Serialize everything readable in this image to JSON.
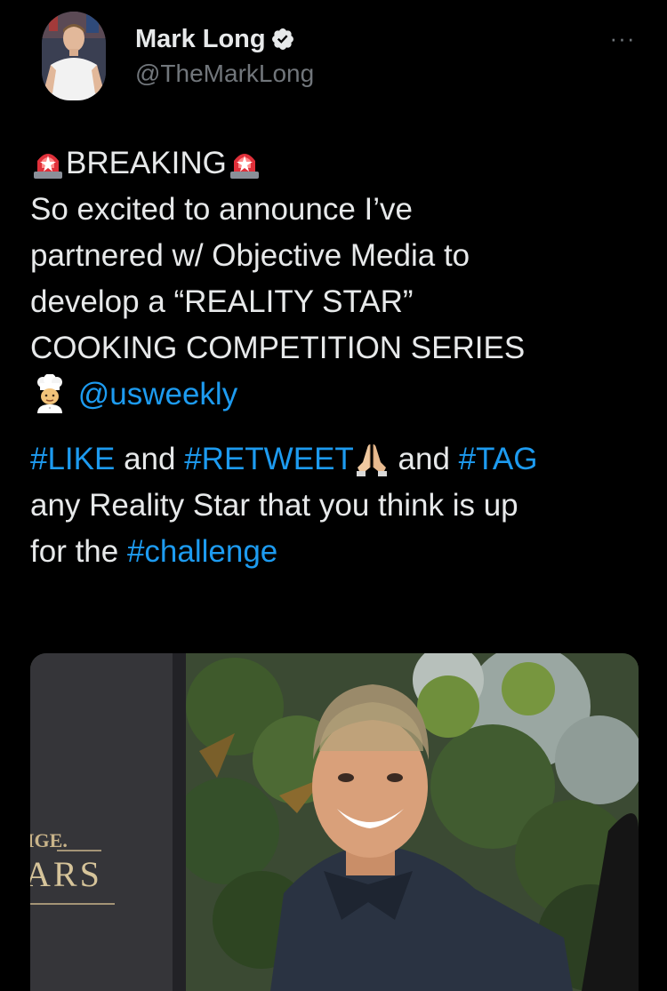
{
  "tweet": {
    "author": {
      "display_name": "Mark Long",
      "handle": "@TheMarkLong",
      "verified": true,
      "avatar_icon": "profile-photo"
    },
    "more_label": "···",
    "text": {
      "breaking": "BREAKING",
      "line1": "So excited to announce I’ve",
      "line2": "partnered w/ Objective Media to",
      "line3": "develop a “REALITY STAR”",
      "line4": "COOKING COMPETITION SERIES",
      "mention": "@usweekly",
      "hashtag_like": "#LIKE",
      "and1": " and ",
      "hashtag_retweet": "#RETWEET",
      "and2": " and ",
      "hashtag_tag": "#TAG",
      "line6": "any Reality Star that you think is up",
      "for_the": "for the ",
      "hashtag_challenge": "#challenge"
    },
    "emojis": {
      "siren": "police-car-light",
      "chef": "cook",
      "pray": "folded-hands"
    },
    "media": {
      "sign_text_1": "IGE.",
      "sign_text_2": "ARS"
    },
    "colors": {
      "background": "#000000",
      "text": "#e7e9ea",
      "secondary": "#71767b",
      "link": "#1d9bf0"
    }
  }
}
